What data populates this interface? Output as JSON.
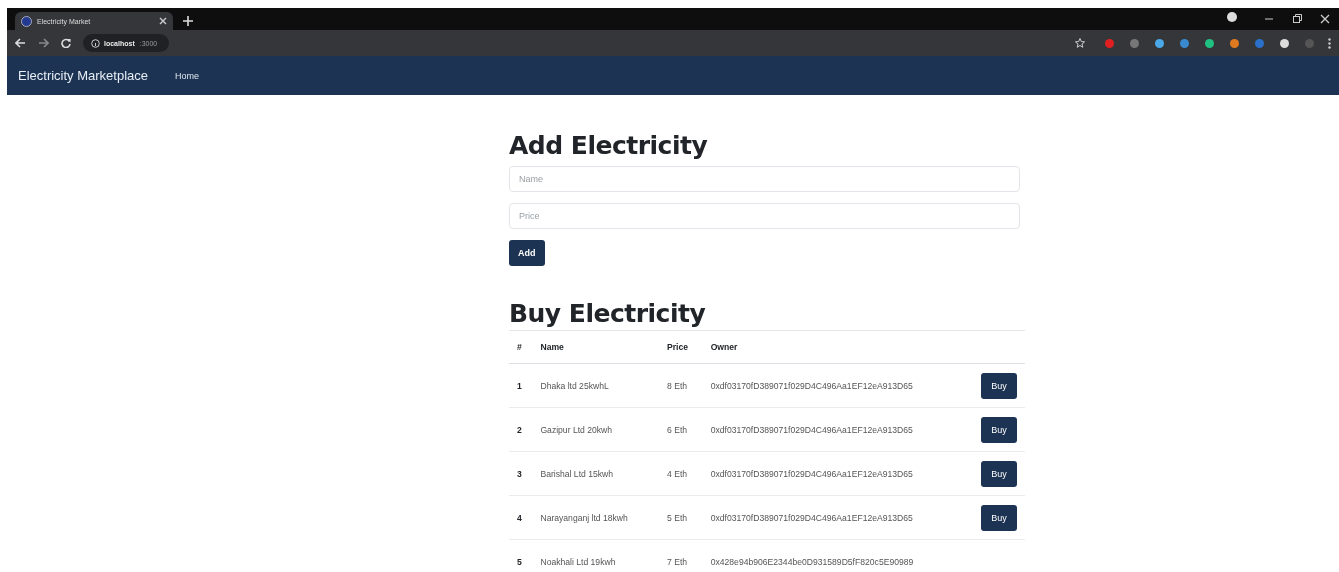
{
  "browser": {
    "tab_title": "Electricity Market",
    "url_host": "localhost",
    "url_port": ":3000"
  },
  "navbar": {
    "brand": "Electricity Marketplace",
    "links": [
      "Home"
    ]
  },
  "add_form": {
    "heading": "Add Electricity",
    "name_placeholder": "Name",
    "price_placeholder": "Price",
    "button": "Add"
  },
  "buy_section": {
    "heading": "Buy Electricity",
    "columns": [
      "#",
      "Name",
      "Price",
      "Owner"
    ],
    "rows": [
      {
        "id": "1",
        "name": "Dhaka ltd 25kwhL",
        "price": "8 Eth",
        "owner": "0xdf03170fD389071f029D4C496Aa1EF12eA913D65",
        "purchased": false,
        "button": "Buy"
      },
      {
        "id": "2",
        "name": "Gazipur Ltd 20kwh",
        "price": "6 Eth",
        "owner": "0xdf03170fD389071f029D4C496Aa1EF12eA913D65",
        "purchased": false,
        "button": "Buy"
      },
      {
        "id": "3",
        "name": "Barishal Ltd 15kwh",
        "price": "4 Eth",
        "owner": "0xdf03170fD389071f029D4C496Aa1EF12eA913D65",
        "purchased": false,
        "button": "Buy"
      },
      {
        "id": "4",
        "name": "Narayanganj ltd 18kwh",
        "price": "5 Eth",
        "owner": "0xdf03170fD389071f029D4C496Aa1EF12eA913D65",
        "purchased": false,
        "button": "Buy"
      },
      {
        "id": "5",
        "name": "Noakhali Ltd 19kwh",
        "price": "7 Eth",
        "owner": "0x428e94b906E2344be0D931589D5fF820c5E90989",
        "purchased": true
      }
    ]
  }
}
